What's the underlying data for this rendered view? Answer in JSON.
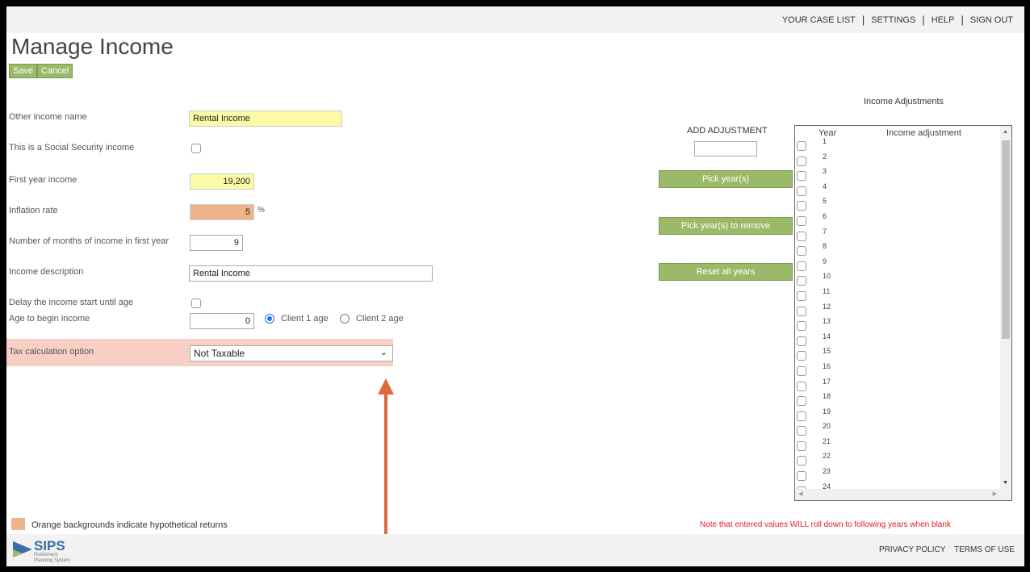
{
  "topnav": {
    "items": [
      "YOUR CASE LIST",
      "SETTINGS",
      "HELP",
      "SIGN OUT"
    ]
  },
  "page": {
    "title": "Manage Income",
    "save_label": "Save",
    "cancel_label": "Cancel"
  },
  "form": {
    "other_income_name_label": "Other income name",
    "other_income_name_value": "Rental Income",
    "social_security_label": "This is a Social Security income",
    "first_year_income_label": "First year income",
    "first_year_income_value": "19,200",
    "inflation_rate_label": "Inflation rate",
    "inflation_rate_value": "5",
    "inflation_unit": "%",
    "months_label": "Number of months of income in first year",
    "months_value": "9",
    "description_label": "Income description",
    "description_value": "Rental Income",
    "delay_label": "Delay the income start until age",
    "age_begin_label": "Age to begin income",
    "age_begin_value": "0",
    "client1_label": "Client 1 age",
    "client2_label": "Client 2 age",
    "tax_option_label": "Tax calculation option",
    "tax_option_value": "Not Taxable"
  },
  "adjustments": {
    "title": "Income Adjustments",
    "add_label": "ADD ADJUSTMENT",
    "pick_years_label": "Pick year(s)",
    "pick_remove_label": "Pick year(s) to remove",
    "reset_label": "Reset all years",
    "col_year": "Year",
    "col_adjustment": "Income adjustment",
    "years": [
      "1",
      "2",
      "3",
      "4",
      "5",
      "6",
      "7",
      "8",
      "9",
      "10",
      "11",
      "12",
      "13",
      "14",
      "15",
      "16",
      "17",
      "18",
      "19",
      "20",
      "21",
      "22",
      "23",
      "24"
    ]
  },
  "legend": {
    "text": "Orange backgrounds indicate hypothetical returns",
    "swatch_color": "#f0b48a"
  },
  "note": "Note that entered values WILL roll down to following years when blank",
  "footer": {
    "privacy": "PRIVACY POLICY",
    "terms": "TERMS OF USE",
    "logo_text": "SIPS",
    "logo_sub_1": "Retirement",
    "logo_sub_2": "Planning System"
  },
  "colors": {
    "accent_green": "#9aba6a",
    "highlight_yellow": "#fdfaa6",
    "highlight_orange": "#f0b48a",
    "tax_band": "#f7cfc4",
    "arrow": "#e0683d",
    "note_red": "#e02020"
  }
}
